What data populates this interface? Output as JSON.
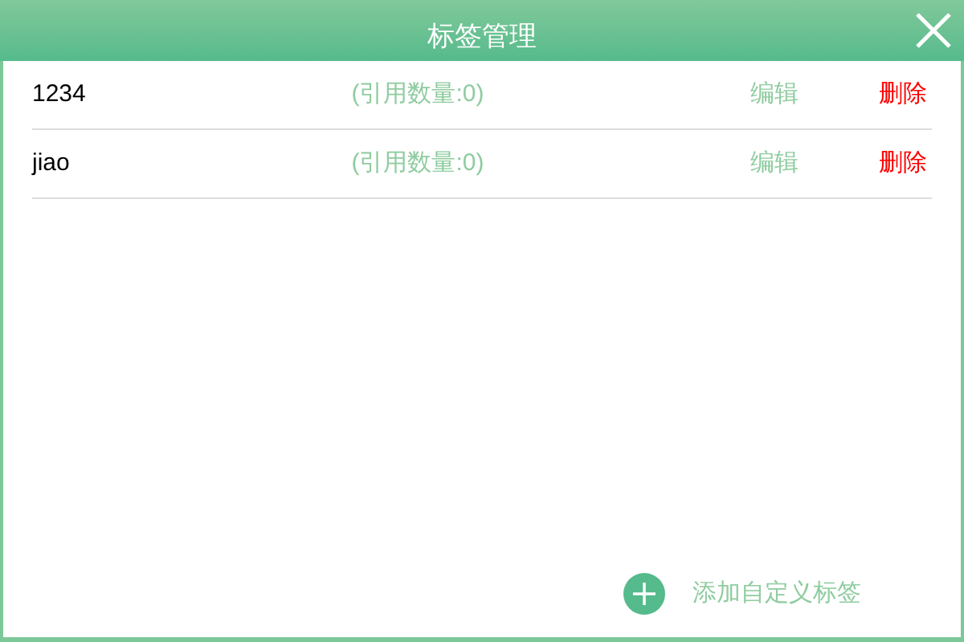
{
  "window": {
    "title": "标签管理"
  },
  "tags": [
    {
      "name": "1234",
      "count": "(引用数量:0)",
      "edit": "编辑",
      "delete": "删除"
    },
    {
      "name": "jiao",
      "count": "(引用数量:0)",
      "edit": "编辑",
      "delete": "删除"
    }
  ],
  "add_button": {
    "label": "添加自定义标签"
  }
}
